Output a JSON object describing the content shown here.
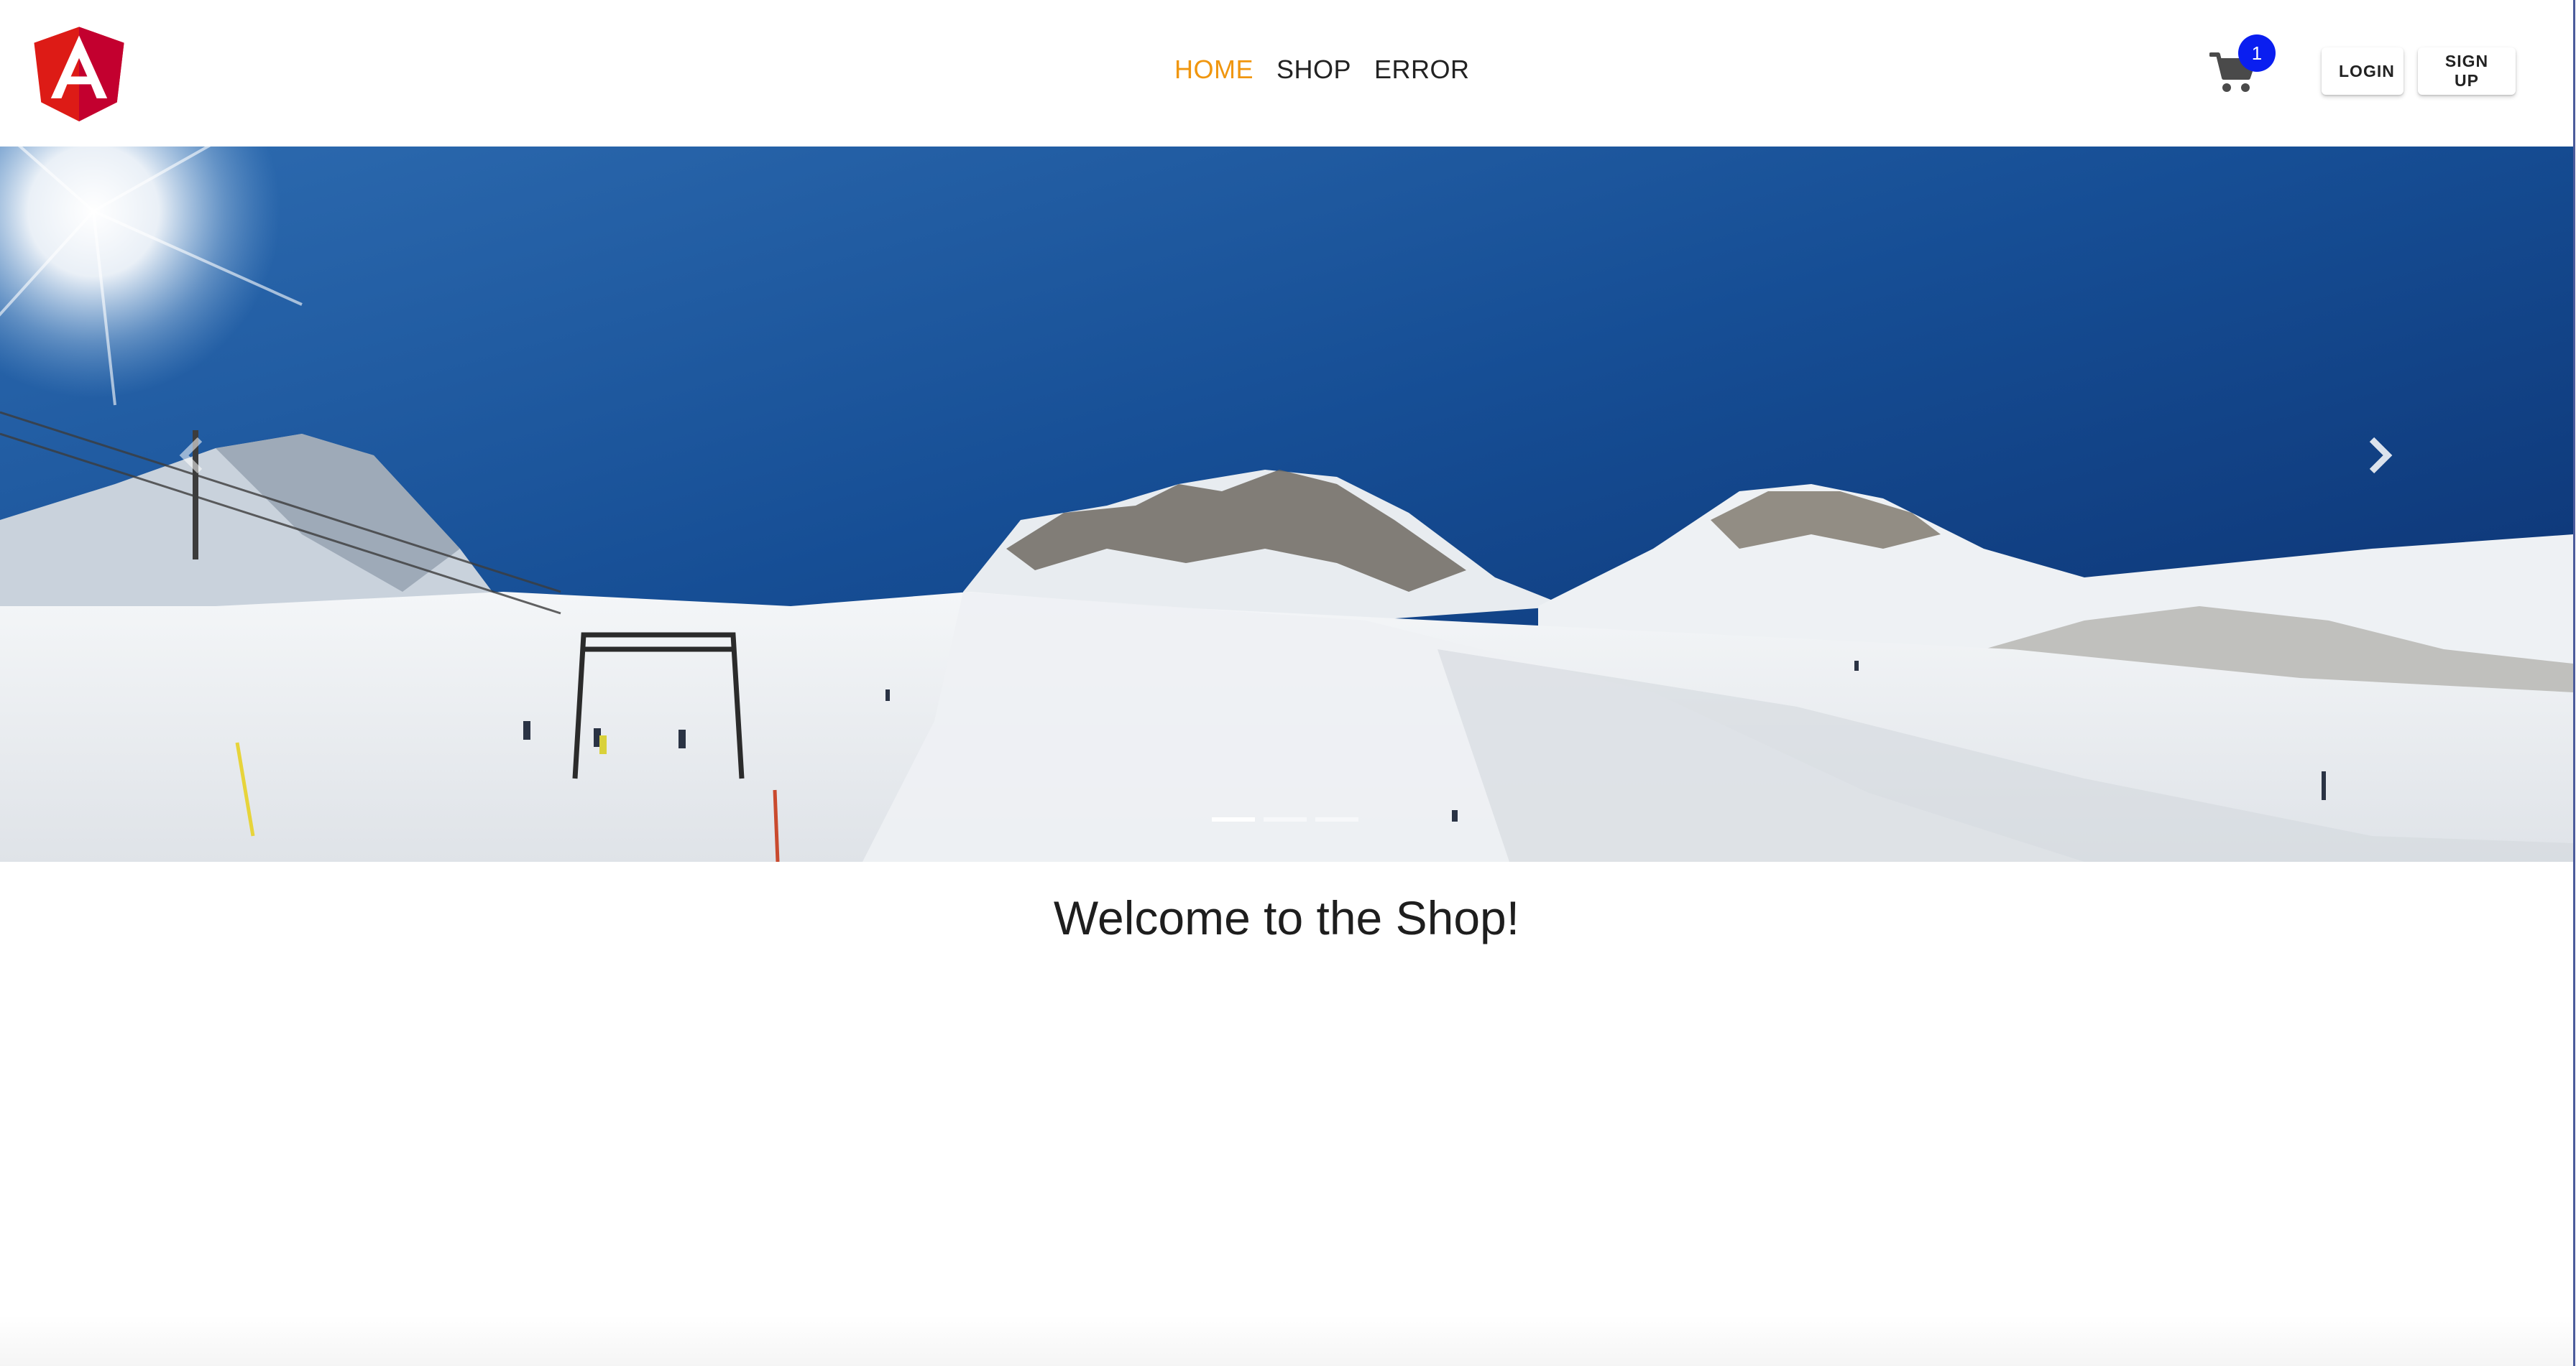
{
  "header": {
    "logo_letter": "A",
    "logo_icon": "angular-logo-icon",
    "nav": [
      {
        "label": "HOME",
        "active": true
      },
      {
        "label": "SHOP",
        "active": false
      },
      {
        "label": "ERROR",
        "active": false
      }
    ],
    "cart": {
      "icon": "cart-icon",
      "count": "1"
    },
    "login_label": "LOGIN",
    "signup_label": "SIGN UP"
  },
  "carousel": {
    "prev_icon": "chevron-left-icon",
    "next_icon": "chevron-right-icon",
    "slide_count": 3,
    "active_index": 0
  },
  "main": {
    "welcome": "Welcome to the Shop!"
  },
  "colors": {
    "nav_active": "#f0960e",
    "badge": "#0a1ef0",
    "logo_red": "#dd1b16",
    "logo_dark_red": "#c3002f"
  }
}
